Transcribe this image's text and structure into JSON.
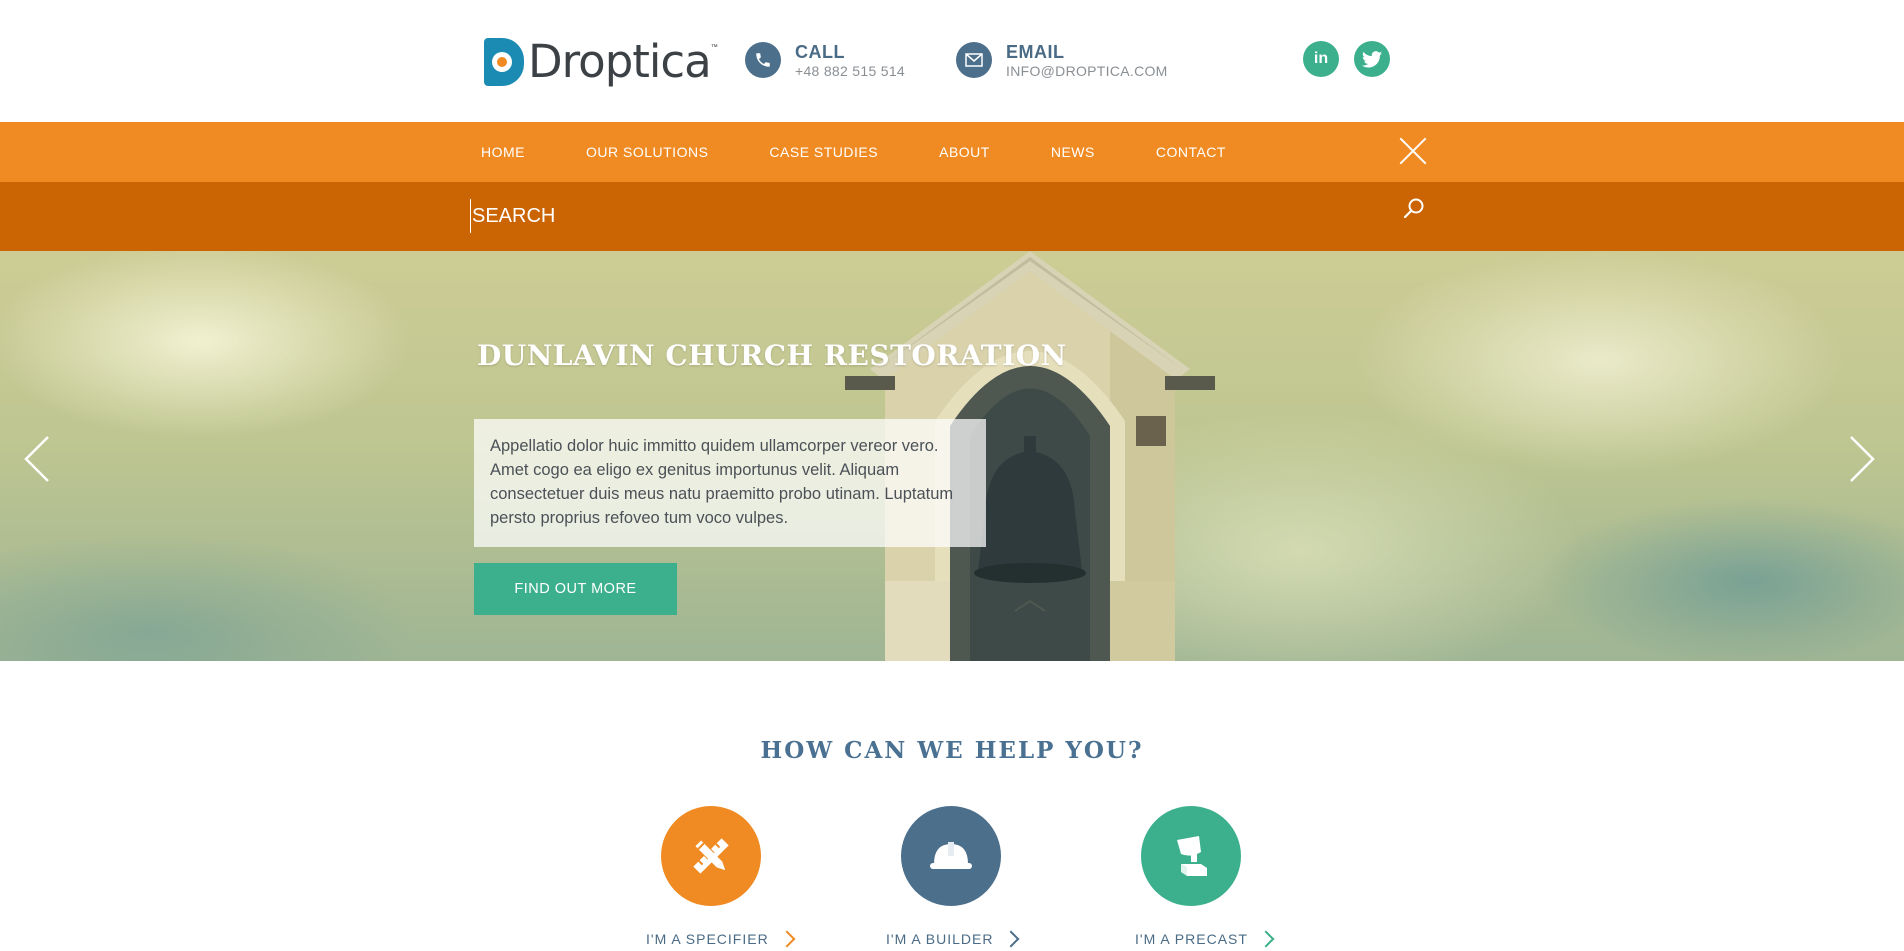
{
  "brand": {
    "name": "Droptica",
    "tm": "™",
    "colors": {
      "orange": "#f08b23",
      "dark_orange": "#cb6402",
      "green": "#3cb08c",
      "blue": "#4c6f8c"
    }
  },
  "contact": {
    "call_label": "CALL",
    "call_value": "+48 882 515 514",
    "email_label": "EMAIL",
    "email_value": "INFO@DROPTICA.COM"
  },
  "social": {
    "linkedin": "in",
    "twitter_icon": "twitter-icon"
  },
  "nav": {
    "items": [
      "HOME",
      "OUR SOLUTIONS",
      "CASE STUDIES",
      "ABOUT",
      "NEWS",
      "CONTACT"
    ]
  },
  "search": {
    "placeholder": "SEARCH"
  },
  "hero": {
    "title": "DUNLAVIN CHURCH RESTORATION",
    "text": "Appellatio dolor huic immitto quidem ullamcorper vereor vero. Amet cogo ea eligo ex genitus importunus velit. Aliquam consectetuer duis meus natu praemitto probo utinam. Luptatum persto proprius refoveo tum voco vulpes.",
    "button": "FIND OUT MORE"
  },
  "help": {
    "title": "HOW CAN WE HELP YOU?",
    "items": [
      {
        "label": "I'M A SPECIFIER",
        "icon": "pencil-ruler-icon"
      },
      {
        "label": "I'M A BUILDER",
        "icon": "hard-hat-icon"
      },
      {
        "label": "I'M A PRECAST",
        "icon": "bucket-pour-icon"
      }
    ]
  }
}
